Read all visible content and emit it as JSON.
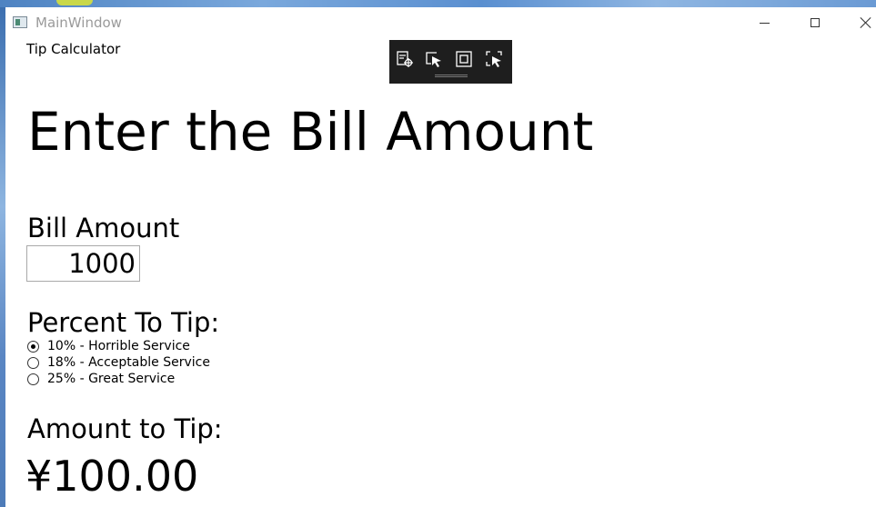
{
  "window": {
    "title": "MainWindow",
    "app_label": "Tip Calculator"
  },
  "main": {
    "heading": "Enter the Bill Amount",
    "bill_label": "Bill Amount",
    "bill_value": "1000",
    "percent_label": "Percent To Tip:",
    "tip_options": [
      {
        "label": "10% - Horrible Service",
        "checked": true
      },
      {
        "label": "18% - Acceptable Service",
        "checked": false
      },
      {
        "label": "25% - Great Service",
        "checked": false
      }
    ],
    "amount_label": "Amount to Tip:",
    "amount_value": "¥100.00"
  },
  "debug_toolbar": {
    "buttons": [
      "live-visual-tree-icon",
      "select-element-icon",
      "display-layout-adorners-icon",
      "track-focused-element-icon"
    ]
  },
  "colors": {
    "title_text": "#9a9a9a",
    "toolbar_bg": "#1e1e1e"
  }
}
